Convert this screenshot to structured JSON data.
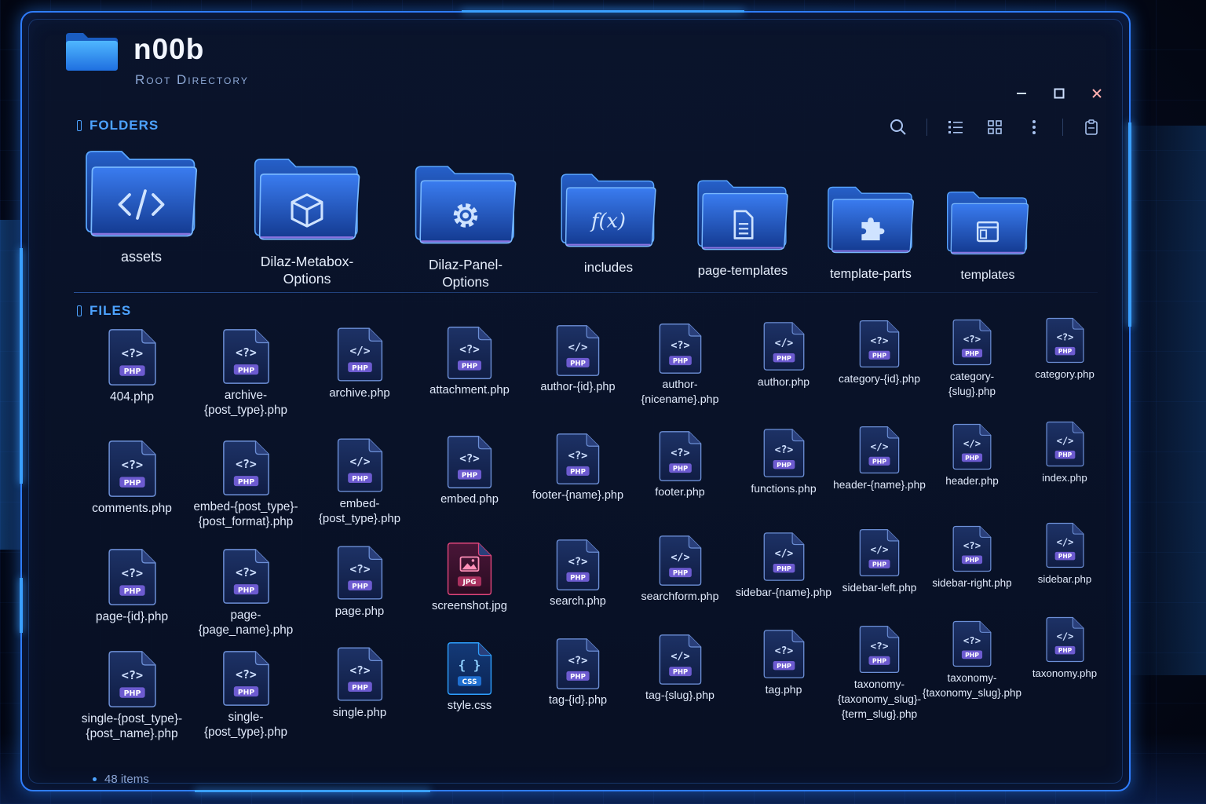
{
  "window": {
    "title": "n00b",
    "subtitle": "Root Directory",
    "controls": {
      "minimize_icon": "minimize-icon",
      "maximize_icon": "maximize-icon",
      "close_icon": "close-icon"
    }
  },
  "toolbar": {
    "buttons": [
      "search-icon",
      "list-view-icon",
      "grid-view-icon",
      "more-options-icon",
      "clipboard-icon"
    ]
  },
  "folders_section": {
    "label": "Folders",
    "items": [
      {
        "name": "assets",
        "icon": "code-icon"
      },
      {
        "name": "Dilaz-Metabox-\nOptions",
        "icon": "cube-icon"
      },
      {
        "name": "Dilaz-Panel-\nOptions",
        "icon": "gear-icon"
      },
      {
        "name": "includes",
        "icon": "function-icon"
      },
      {
        "name": "page-templates",
        "icon": "document-icon"
      },
      {
        "name": "template-parts",
        "icon": "puzzle-icon"
      },
      {
        "name": "templates",
        "icon": "window-icon"
      }
    ]
  },
  "files_section": {
    "label": "Files",
    "items": [
      {
        "name": "404.php",
        "type": "PHP",
        "glyph": "<?>"
      },
      {
        "name": "archive-\n{post_type}.php",
        "type": "PHP",
        "glyph": "<?>"
      },
      {
        "name": "archive.php",
        "type": "PHP",
        "glyph": "</>"
      },
      {
        "name": "attachment.php",
        "type": "PHP",
        "glyph": "<?>"
      },
      {
        "name": "author-{id}.php",
        "type": "PHP",
        "glyph": "</>"
      },
      {
        "name": "author-\n{nicename}.php",
        "type": "PHP",
        "glyph": "<?>"
      },
      {
        "name": "author.php",
        "type": "PHP",
        "glyph": "</>"
      },
      {
        "name": "category-{id}.php",
        "type": "PHP",
        "glyph": "<?>"
      },
      {
        "name": "category-\n{slug}.php",
        "type": "PHP",
        "glyph": "<?>"
      },
      {
        "name": "category.php",
        "type": "PHP",
        "glyph": "<?>"
      },
      {
        "name": "comments.php",
        "type": "PHP",
        "glyph": "<?>"
      },
      {
        "name": "embed-{post_type}-\n{post_format}.php",
        "type": "PHP",
        "glyph": "<?>"
      },
      {
        "name": "embed-{post_type}.php",
        "type": "PHP",
        "glyph": "</>"
      },
      {
        "name": "embed.php",
        "type": "PHP",
        "glyph": "<?>"
      },
      {
        "name": "footer-{name}.php",
        "type": "PHP",
        "glyph": "<?>"
      },
      {
        "name": "footer.php",
        "type": "PHP",
        "glyph": "<?>"
      },
      {
        "name": "functions.php",
        "type": "PHP",
        "glyph": "<?>"
      },
      {
        "name": "header-{name}.php",
        "type": "PHP",
        "glyph": "</>"
      },
      {
        "name": "header.php",
        "type": "PHP",
        "glyph": "</>"
      },
      {
        "name": "index.php",
        "type": "PHP",
        "glyph": "</>"
      },
      {
        "name": "page-{id}.php",
        "type": "PHP",
        "glyph": "<?>"
      },
      {
        "name": "page-{page_name}.php",
        "type": "PHP",
        "glyph": "<?>"
      },
      {
        "name": "page.php",
        "type": "PHP",
        "glyph": "<?>"
      },
      {
        "name": "screenshot.jpg",
        "type": "JPG",
        "glyph": "image"
      },
      {
        "name": "search.php",
        "type": "PHP",
        "glyph": "<?>"
      },
      {
        "name": "searchform.php",
        "type": "PHP",
        "glyph": "</>"
      },
      {
        "name": "sidebar-{name}.php",
        "type": "PHP",
        "glyph": "</>"
      },
      {
        "name": "sidebar-left.php",
        "type": "PHP",
        "glyph": "</>"
      },
      {
        "name": "sidebar-right.php",
        "type": "PHP",
        "glyph": "<?>"
      },
      {
        "name": "sidebar.php",
        "type": "PHP",
        "glyph": "</>"
      },
      {
        "name": "single-{post_type}-\n{post_name}.php",
        "type": "PHP",
        "glyph": "<?>"
      },
      {
        "name": "single-{post_type}.php",
        "type": "PHP",
        "glyph": "<?>"
      },
      {
        "name": "single.php",
        "type": "PHP",
        "glyph": "<?>"
      },
      {
        "name": "style.css",
        "type": "CSS",
        "glyph": "{}"
      },
      {
        "name": "tag-{id}.php",
        "type": "PHP",
        "glyph": "<?>"
      },
      {
        "name": "tag-{slug}.php",
        "type": "PHP",
        "glyph": "</>"
      },
      {
        "name": "tag.php",
        "type": "PHP",
        "glyph": "<?>"
      },
      {
        "name": "taxonomy-\n{taxonomy_slug}-\n{term_slug}.php",
        "type": "PHP",
        "glyph": "<?>"
      },
      {
        "name": "taxonomy-\n{taxonomy_slug}.php",
        "type": "PHP",
        "glyph": "<?>"
      },
      {
        "name": "taxonomy.php",
        "type": "PHP",
        "glyph": "</>"
      }
    ]
  },
  "status": {
    "count": "48 items"
  },
  "colors": {
    "accent": "#2f7dff",
    "php_badge": "#6d5bd0",
    "jpg_accent": "#e0457b",
    "css_accent": "#2ea0ff"
  }
}
